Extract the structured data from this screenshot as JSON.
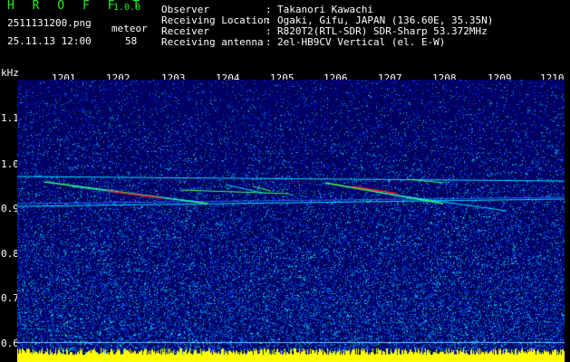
{
  "header": {
    "title": "H R O F F T",
    "version": "1.0.0",
    "filename": "2511131200.png",
    "datetime": "25.11.13 12:00",
    "detector_label": "meteor",
    "count": "58"
  },
  "info": [
    {
      "label": "Observer",
      "value": "Takanori Kawachi"
    },
    {
      "label": "Receiving Location",
      "value": "Ogaki, Gifu, JAPAN (136.60E, 35.35N)"
    },
    {
      "label": "Receiver",
      "value": "R820T2(RTL-SDR) SDR-Sharp 53.372MHz"
    },
    {
      "label": "Receiving antenna",
      "value": "2el-HB9CV Vertical (el. E-W)"
    }
  ],
  "axis": {
    "unit": "kHz",
    "time_ticks": [
      "1201",
      "1202",
      "1203",
      "1204",
      "1205",
      "1206",
      "1207",
      "1208",
      "1209",
      "1210"
    ],
    "freq_ticks": [
      "1.1",
      "1.0",
      "0.9",
      "0.8",
      "0.7",
      "0.6"
    ]
  },
  "colors": {
    "title_green": "#22ee22",
    "background": "#000000",
    "noise_dark": "#000080",
    "noise_mid": "#0000ff",
    "signal_cyan": "#00e0ff",
    "signal_green": "#40ff60",
    "signal_red": "#ff2020",
    "baseline_yellow": "#ffff00"
  }
}
